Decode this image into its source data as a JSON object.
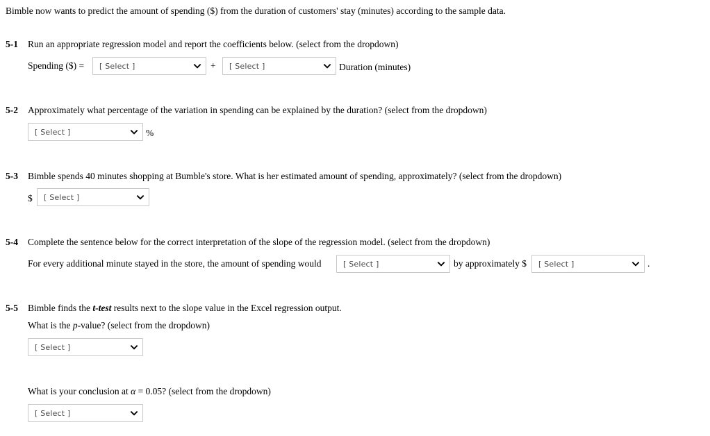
{
  "intro": "Bimble now wants to predict the amount of spending ($) from the duration of customers' stay (minutes) according to the sample data.",
  "select_placeholder": "[ Select ]",
  "questions": [
    {
      "number": "5-1",
      "prompt": "Run an appropriate regression model and report the coefficients below. (select from the dropdown)",
      "equation_lhs": "Spending ($) =",
      "plus_sign": "+",
      "equation_rhs": "Duration (minutes)"
    },
    {
      "number": "5-2",
      "prompt": "Approximately what percentage of the variation in spending can be explained by the duration? (select from the dropdown)",
      "unit": "%"
    },
    {
      "number": "5-3",
      "prompt": "Bimble spends 40 minutes shopping at Bumble's store. What is her estimated amount of spending, approximately? (select from the dropdown)",
      "currency": "$"
    },
    {
      "number": "5-4",
      "prompt": "Complete the sentence below for the correct interpretation of the slope of the regression model. (select from the dropdown)",
      "sentence_part1": "For every additional minute stayed in the store, the amount of spending would",
      "sentence_part2": "by approximately $",
      "sentence_end": "."
    },
    {
      "number": "5-5",
      "prompt_pre": "Bimble finds the ",
      "prompt_emph": "t-test",
      "prompt_post": " results next to the slope value in the Excel regression output.",
      "sub_prompt_pre": "What is the ",
      "sub_prompt_emph": "p",
      "sub_prompt_post": "-value? (select from the dropdown)",
      "conclusion_pre": "What is your conclusion at ",
      "conclusion_alpha": "α",
      "conclusion_post": " = 0.05? (select from the dropdown)"
    }
  ],
  "colors": {
    "text": "#000000",
    "select_border": "#c8c8c8",
    "select_text": "#4a4a4a",
    "background": "#ffffff"
  }
}
